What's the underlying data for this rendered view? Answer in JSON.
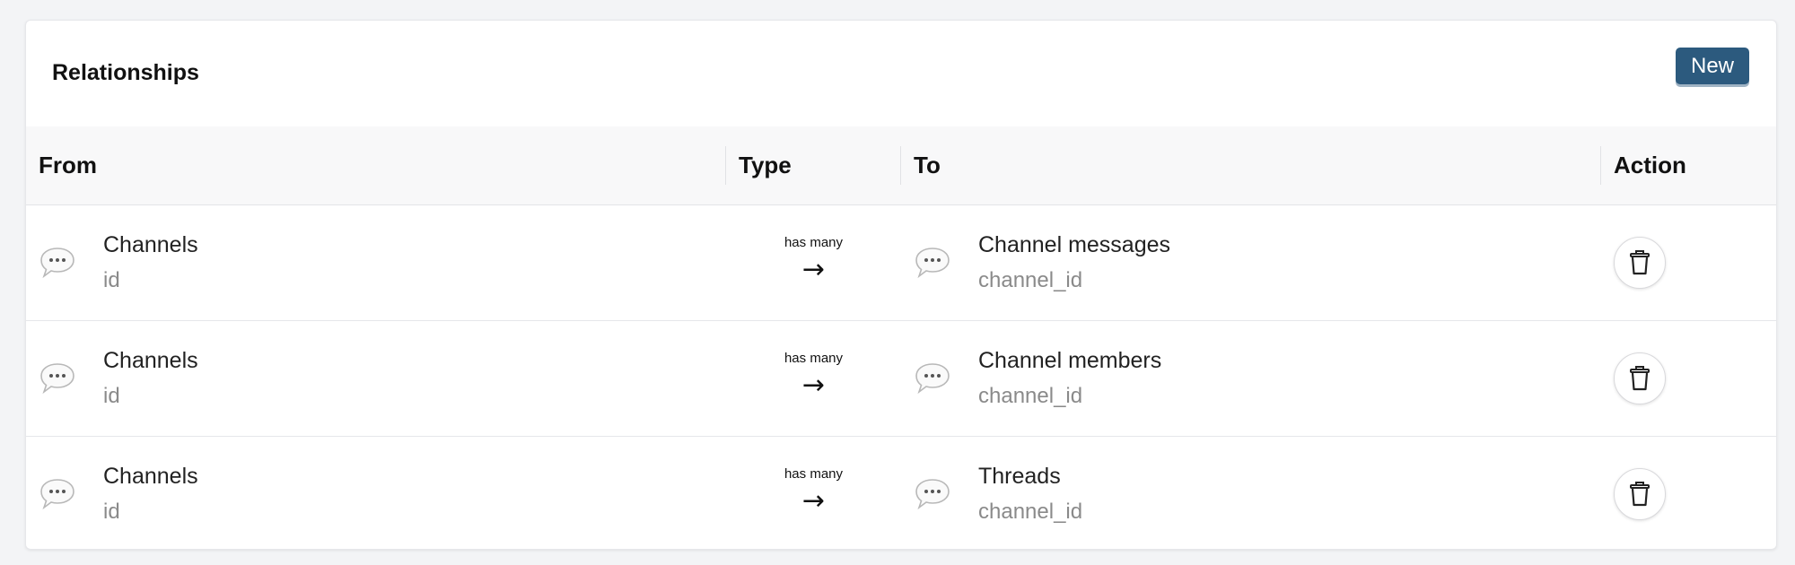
{
  "header": {
    "title": "Relationships",
    "new_button_label": "New"
  },
  "table": {
    "columns": [
      "From",
      "Type",
      "To",
      "Action"
    ],
    "rows": [
      {
        "from_name": "Channels",
        "from_field": "id",
        "type_label": "has many",
        "type_arrow": "→",
        "to_name": "Channel messages",
        "to_field": "channel_id",
        "from_icon": "speech-bubble-icon",
        "to_icon": "speech-bubble-icon",
        "action_icon": "trash-icon"
      },
      {
        "from_name": "Channels",
        "from_field": "id",
        "type_label": "has many",
        "type_arrow": "→",
        "to_name": "Channel members",
        "to_field": "channel_id",
        "from_icon": "speech-bubble-icon",
        "to_icon": "speech-bubble-icon",
        "action_icon": "trash-icon"
      },
      {
        "from_name": "Channels",
        "from_field": "id",
        "type_label": "has many",
        "type_arrow": "→",
        "to_name": "Threads",
        "to_field": "channel_id",
        "from_icon": "speech-bubble-icon",
        "to_icon": "speech-bubble-icon",
        "action_icon": "trash-icon"
      }
    ]
  },
  "colors": {
    "accent": "#2c5a7e",
    "page_background": "#f3f4f6",
    "muted_text": "#8a8a8a"
  }
}
